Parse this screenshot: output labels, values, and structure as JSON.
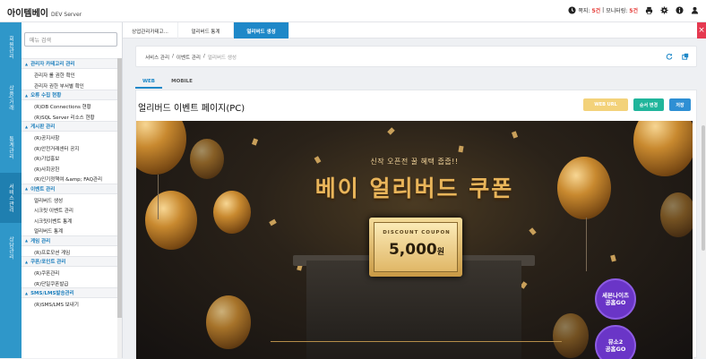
{
  "app": {
    "title": "아이템베이",
    "env": "DEV Server"
  },
  "topbar": {
    "status_prefix": "쪽지:",
    "messages_count": "5건",
    "separator": "|",
    "monitoring_label": "모니터링:",
    "monitoring_count": "5건",
    "icons": [
      "clock-icon",
      "print-icon",
      "gear-icon",
      "info-icon",
      "user-icon"
    ]
  },
  "rail": [
    "회원관리",
    "상품/거래",
    "통계관리",
    "서비스관리",
    "상담관리"
  ],
  "search": {
    "placeholder": "메뉴 검색"
  },
  "menu": [
    {
      "group": "관리자 카테고리 관리",
      "items": [
        "관리자 롤 권한 확인",
        "관리자 권한 부서별 확인"
      ]
    },
    {
      "group": "오류 수집 현황",
      "items": [
        "(R)DB Connections 현황",
        "(R)SQL Server 리소스 현황"
      ]
    },
    {
      "group": "게시판 관리",
      "items": [
        "(R)공지사항",
        "(R)안전거래센터 공지",
        "(R)기업홍보",
        "(R)사회공헌",
        "(R)인기정책여 &amp; FAQ관리"
      ]
    },
    {
      "group": "이벤트 관리",
      "items": [
        "얼리버드 생성",
        "시크릿 이벤트 관리",
        "시크릿이벤트 통계",
        "얼리버드 통계"
      ]
    },
    {
      "group": "게임 관리",
      "items": [
        "(R)프로모션 게임"
      ]
    },
    {
      "group": "쿠폰/포인트 관리",
      "items": [
        "(R)쿠폰관리",
        "(R)단일쿠폰발급"
      ]
    },
    {
      "group": "SMS/LMS발송관리",
      "items": [
        "(R)SMS/LMS 보내기"
      ]
    }
  ],
  "tabs": [
    "상업관리카테고...",
    "얼리버드 통계",
    "얼리버드 생성"
  ],
  "breadcrumb": {
    "a": "서비스 관리",
    "sep": "/",
    "b": "이벤트 관리",
    "c": "얼리버드 생성"
  },
  "subtabs": [
    "WEB",
    "MOBILE"
  ],
  "page": {
    "title": "얼리버드 이벤트 페이지(PC)"
  },
  "buttons": {
    "web_url": "WEB URL",
    "order": "순서 변경",
    "save": "저장"
  },
  "banner": {
    "subtitle": "신작 오픈전 꿀 혜택 줍줍!!",
    "title": "베이 얼리버드 쿠폰",
    "coupon_label": "DISCOUNT COUPON",
    "coupon_amount": "5,000",
    "coupon_unit": "원",
    "pill1": "세븐나이츠\n공홈GO",
    "pill2": "뮤소2\n공홈GO"
  },
  "colors": {
    "accent": "#1e88c8",
    "rail": "#2f97c9",
    "close": "#e53950",
    "teal": "#20b59b",
    "gold": "#e9b55a",
    "pill": "#6a35c7"
  }
}
